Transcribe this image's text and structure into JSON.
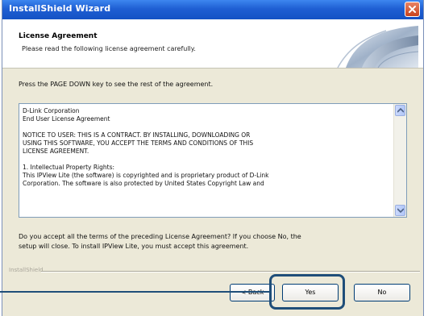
{
  "window": {
    "title": "InstallShield Wizard"
  },
  "header": {
    "title": "License Agreement",
    "subtitle": "Please read the following license agreement carefully."
  },
  "instruction": "Press the PAGE DOWN key to see the rest of the agreement.",
  "license": {
    "lines": [
      "D-Link Corporation",
      "End User License Agreement",
      "",
      "NOTICE TO USER:  THIS IS A CONTRACT.  BY INSTALLING, DOWNLOADING OR",
      "USING THIS SOFTWARE, YOU ACCEPT THE TERMS AND CONDITIONS OF THIS",
      "LICENSE AGREEMENT.",
      "",
      "1.  Intellectual Property Rights:",
      "This IPView Lite (the software) is copyrighted and is proprietary product of D-Link",
      "Corporation.  The software is also protected by United States Copyright Law and"
    ]
  },
  "question": {
    "line1": "Do you accept all the terms of the preceding License Agreement?  If you choose No,  the",
    "line2": "setup will close.  To install IPView Lite, you must accept this agreement."
  },
  "brand": "InstallShield",
  "buttons": {
    "back": "< Back",
    "yes": "Yes",
    "no": "No"
  },
  "icons": {
    "close": "close-icon",
    "scroll_up": "scroll-up-arrow-icon",
    "scroll_down": "scroll-down-arrow-icon",
    "header_art": "page-curl-graphic"
  },
  "colors": {
    "titlebar": "#1f5fd3",
    "dialog_background": "#ece9d8",
    "callout": "#1f4e79"
  }
}
